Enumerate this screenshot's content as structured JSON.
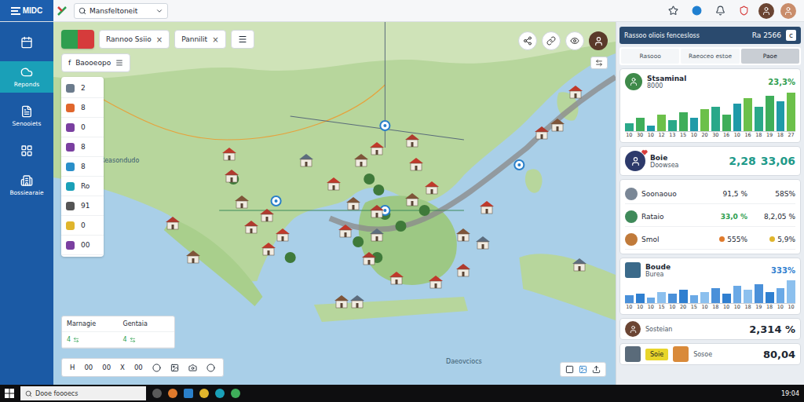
{
  "app": {
    "logo": "MIDC"
  },
  "search": {
    "value": "Mansfeltoneit"
  },
  "sidebar": {
    "items": [
      {
        "selected": false
      },
      {
        "label": "Reponds",
        "selected": true
      },
      {
        "label": "Senooiets",
        "selected": false
      },
      {
        "selected": false
      },
      {
        "label": "Bossiearaie",
        "selected": false
      }
    ]
  },
  "map": {
    "tabs": [
      {
        "label": "Rannoo Ssiio",
        "close": "×"
      },
      {
        "label": "Pannilit",
        "close": "×"
      }
    ],
    "layer_select": {
      "prefix": "f",
      "label": "Baooeopo"
    },
    "layer_list": [
      {
        "value": "2",
        "color": "#6b7b8c"
      },
      {
        "value": "8",
        "color": "#e0662c"
      },
      {
        "value": "0",
        "color": "#7a3fa0"
      },
      {
        "value": "8",
        "color": "#7a3fa0"
      },
      {
        "value": "8",
        "color": "#2a8fc9"
      },
      {
        "value": "Ro",
        "color": "#1aa0b8"
      },
      {
        "value": "91",
        "color": "#555555"
      },
      {
        "value": "0",
        "color": "#e0b52c"
      },
      {
        "value": "00",
        "color": "#7a3fa0"
      }
    ],
    "place_labels": [
      "Reasondudo",
      "Daeovciocs"
    ],
    "legend": {
      "columns": [
        "Marnagie",
        "Gentaia"
      ],
      "values": [
        "4",
        "4"
      ]
    },
    "toolbar": [
      "H",
      "00",
      "00",
      "X",
      "00"
    ]
  },
  "panel": {
    "title": "Rassoo oliois fencesloss",
    "count": "Ra  2566",
    "button": "c",
    "tabs": [
      {
        "label": "Rasooo",
        "selected": false
      },
      {
        "label": "Raeoceo estoe",
        "selected": false
      },
      {
        "label": "Paoe",
        "selected": true
      }
    ],
    "growth": {
      "name": "Stsaminal",
      "sub": "8000",
      "value": "23,3%",
      "values": [
        3,
        5,
        2,
        6,
        4,
        7,
        5,
        8,
        9,
        6,
        10,
        12,
        9,
        13,
        11,
        14
      ],
      "ticks": [
        "10",
        "30",
        "10",
        "12",
        "13",
        "15",
        "10",
        "20",
        "30",
        "16",
        "10",
        "16",
        "18",
        "19",
        "18",
        "27"
      ]
    },
    "summary": {
      "name": "Boie",
      "sub": "Doowsea",
      "value_a": "2,28",
      "value_b": "33,06"
    },
    "metrics": [
      {
        "name": "Soonaouo",
        "value": "91,5 %",
        "change": "58S%",
        "positive": false
      },
      {
        "name": "Rataio",
        "value": "33,0 %",
        "change": "8,2,05 %",
        "positive": true
      },
      {
        "name": "Smol",
        "value": "555%",
        "change": "5,9%",
        "positive": false,
        "dots": [
          "#e07a2c",
          "#e0b52c"
        ]
      }
    ],
    "trend": {
      "name": "Boude",
      "sub": "Burea",
      "value": "333%",
      "values": [
        4,
        5,
        3,
        6,
        5,
        7,
        4,
        6,
        8,
        5,
        9,
        7,
        10,
        6,
        8,
        12
      ],
      "ticks": [
        "10",
        "10",
        "10",
        "15",
        "10",
        "20",
        "15",
        "10",
        "18",
        "10",
        "10",
        "18",
        "19",
        "18",
        "10",
        "10"
      ]
    },
    "footer_rows": [
      {
        "name": "Sosteian",
        "value": "2,314 %"
      },
      {
        "badge": "Soie",
        "name": "Sosoe",
        "value": "80,04"
      }
    ]
  },
  "taskbar": {
    "search": "Dooe foooecs",
    "clock": "19:04"
  }
}
